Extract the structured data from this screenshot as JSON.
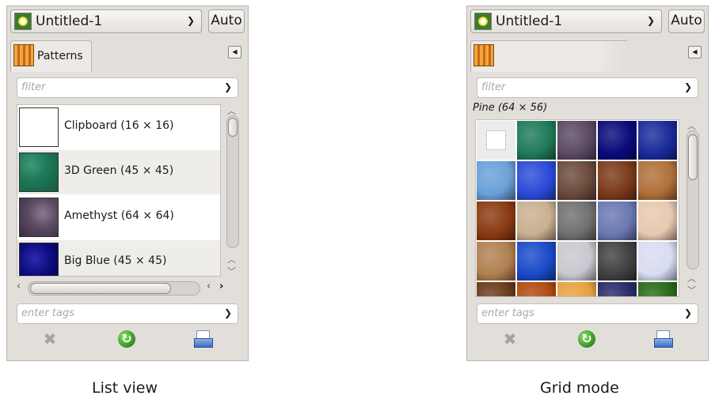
{
  "list_panel": {
    "image_name": "Untitled-1",
    "auto_label": "Auto",
    "tab_label": "Patterns",
    "filter_placeholder": "filter",
    "tags_placeholder": "enter tags",
    "patterns": [
      {
        "label": "Clipboard (16 × 16)",
        "color": "#ffffff"
      },
      {
        "label": "3D Green (45 × 45)",
        "color": "#1f7a5a"
      },
      {
        "label": "Amethyst (64 × 64)",
        "color": "#5a4a62"
      },
      {
        "label": "Big Blue (45 × 45)",
        "color": "#0a0a7a"
      }
    ],
    "caption": "List view"
  },
  "grid_panel": {
    "image_name": "Untitled-1",
    "auto_label": "Auto",
    "filter_placeholder": "filter",
    "selected_label": "Pine (64 × 56)",
    "tags_placeholder": "enter tags",
    "caption": "Grid mode"
  },
  "grid_colors": [
    "#ffffff",
    "#1f7a5a",
    "#5a4a62",
    "#0a0a7a",
    "#1a2a9a",
    "#6aa0d8",
    "#2a4ad8",
    "#6a4a3a",
    "#7a3a1a",
    "#b0703a",
    "#8a3a10",
    "#c8b090",
    "#707070",
    "#6a78b0",
    "#e8c8b0",
    "#b08050",
    "#1a4ac8",
    "#c8c8d0",
    "#404040",
    "#d8dcf0",
    "#6a3a1a",
    "#b04a10",
    "#e8a040",
    "#2a2a6a",
    "#2a6a1a"
  ]
}
